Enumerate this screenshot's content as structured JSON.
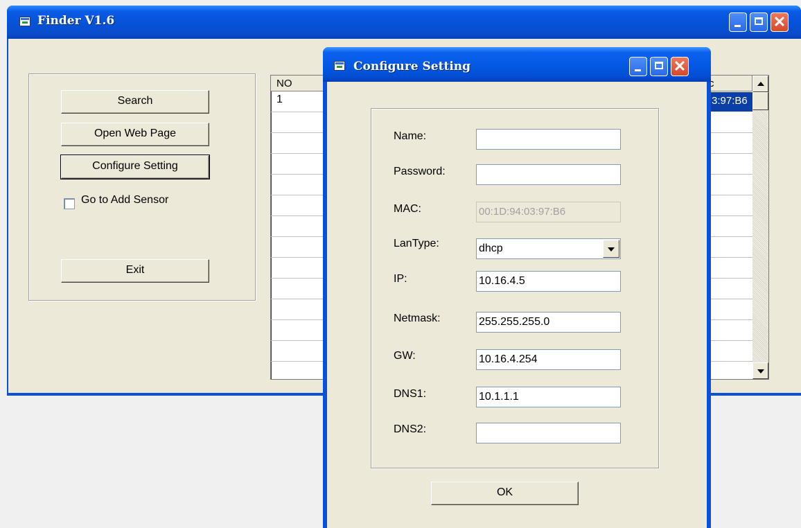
{
  "main_window": {
    "title": "Finder V1.6",
    "buttons": {
      "search": "Search",
      "open_web_page": "Open Web Page",
      "configure_setting": "Configure Setting",
      "exit": "Exit"
    },
    "checkbox": {
      "label": "Go to Add Sensor",
      "checked": false
    },
    "grid": {
      "columns": [
        "NO",
        "c"
      ],
      "rows": [
        {
          "no": "1",
          "mac_partial": "3:97:B6",
          "selected": true
        }
      ]
    }
  },
  "dialog": {
    "title": "Configure Setting",
    "labels": {
      "name": "Name:",
      "password": "Password:",
      "mac": "MAC:",
      "lantype": "LanType:",
      "ip": "IP:",
      "netmask": "Netmask:",
      "gw": "GW:",
      "dns1": "DNS1:",
      "dns2": "DNS2:"
    },
    "values": {
      "name": "",
      "password": "",
      "mac": "00:1D:94:03:97:B6",
      "lantype": "dhcp",
      "ip": "10.16.4.5",
      "netmask": "255.255.255.0",
      "gw": "10.16.4.254",
      "dns1": "10.1.1.1",
      "dns2": ""
    },
    "ok_label": "OK"
  },
  "colors": {
    "titlebar": "#0a5ae6",
    "face": "#ece9d8",
    "selection": "#0a3fa8",
    "close_button": "#d34a2a"
  },
  "icons": [
    "app-icon",
    "minimize-icon",
    "maximize-icon",
    "close-icon",
    "scroll-up-icon",
    "scroll-down-icon",
    "dropdown-arrow-icon"
  ]
}
